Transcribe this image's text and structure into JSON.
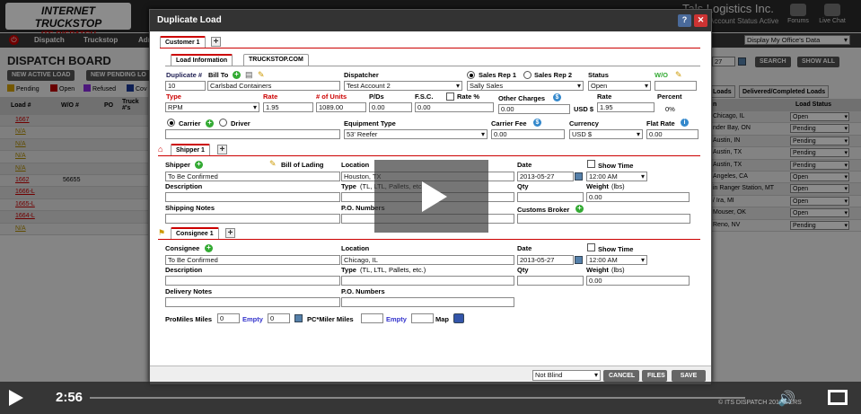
{
  "app": {
    "logo_main": "INTERNET TRUCKSTOP",
    "logo_sub": "ITS DISPATCH",
    "company": "Tals Logistics Inc.",
    "company_status": "Account Status Active",
    "forums": "Forums",
    "live_chat": "Live Chat"
  },
  "nav": [
    "Dispatch",
    "Truckstop",
    "Adm"
  ],
  "board": {
    "title": "DISPATCH BOARD",
    "new_active": "NEW ACTIVE LOAD",
    "new_pending": "NEW PENDING LO",
    "display_select": "Display My Office's Data",
    "date_partial": "27",
    "search": "SEARCH",
    "show_all": "SHOW ALL",
    "legend": [
      "Pending",
      "Open",
      "Refused",
      "Cov"
    ],
    "legend_colors": [
      "#d4a000",
      "#c00000",
      "#8a2be2",
      "#1a3a9a"
    ],
    "columns": [
      "Load #",
      "W/O #",
      "PO",
      "Truck #'s"
    ],
    "rows": [
      {
        "load": "1667",
        "wo": ""
      },
      {
        "load": "N/A",
        "wo": ""
      },
      {
        "load": "N/A",
        "wo": ""
      },
      {
        "load": "N/A",
        "wo": ""
      },
      {
        "load": "N/A",
        "wo": ""
      },
      {
        "load": "1662",
        "wo": "56655"
      },
      {
        "load": "1666-L",
        "wo": ""
      },
      {
        "load": "1665-L",
        "wo": ""
      },
      {
        "load": "1664-L",
        "wo": ""
      },
      {
        "load": "N/A",
        "wo": ""
      }
    ],
    "right_tabs": [
      "Loads",
      "Delivered/Completed Loads"
    ],
    "right_cols": [
      "n",
      "Load Status"
    ],
    "right_rows": [
      {
        "city": "Chicago, IL",
        "status": "Open"
      },
      {
        "city": "nder Bay, ON",
        "status": "Pending"
      },
      {
        "city": "Austin, IN",
        "status": "Pending"
      },
      {
        "city": "Austin, TX",
        "status": "Pending"
      },
      {
        "city": "Austin, TX",
        "status": "Pending"
      },
      {
        "city": "Angeles, CA",
        "status": "Open"
      },
      {
        "city": "in Ranger Station, MT",
        "status": "Open"
      },
      {
        "city": "/ Ira, MI",
        "status": "Open"
      },
      {
        "city": "Mouser, OK",
        "status": "Open"
      },
      {
        "city": "Reno, NV",
        "status": "Pending"
      }
    ]
  },
  "modal": {
    "title": "Duplicate Load",
    "customer_tab": "Customer 1",
    "tab_load_info": "Load Information",
    "tab_truckstop": "TRUCKSTOP.COM",
    "duplicate_label": "Duplicate #",
    "bill_to_label": "Bill To",
    "duplicate_value": "10",
    "bill_to_value": "Carlsbad Containers",
    "dispatcher_label": "Dispatcher",
    "dispatcher_value": "Test Account 2",
    "sales_rep1": "Sales Rep 1",
    "sales_rep2": "Sales Rep 2",
    "sales_value": "Sally Sales",
    "status_label": "Status",
    "status_value": "Open",
    "wo_label": "W/O",
    "wo_value": "",
    "type_label": "Type",
    "type_value": "RPM",
    "rate_label": "Rate",
    "rate_value": "1.95",
    "units_label": "# of Units",
    "units_value": "1089.00",
    "pd_label": "P/Ds",
    "pd_value": "0.00",
    "fsc_label": "F.S.C.",
    "fsc_value": "0.00",
    "rate_pct_label": "Rate %",
    "other_label": "Other Charges",
    "other_value": "0.00",
    "usd_label": "USD $",
    "rate2_label": "Rate",
    "rate2_value": "1.95",
    "percent_label": "Percent",
    "percent_value": "0%",
    "carrier_label": "Carrier",
    "driver_label": "Driver",
    "carrier_value": "",
    "equip_label": "Equipment Type",
    "equip_value": "53' Reefer",
    "carrier_fee_label": "Carrier Fee",
    "carrier_fee_value": "0.00",
    "currency_label": "Currency",
    "currency_value": "USD $",
    "flat_rate_label": "Flat Rate",
    "flat_rate_value": "0.00",
    "shipper_tab": "Shipper 1",
    "shipper_label": "Shipper",
    "bol_label": "Bill of Lading",
    "shipper_value": "To Be Confirmed",
    "location_label": "Location",
    "shipper_location": "Houston, TX",
    "date_label": "Date",
    "shipper_date": "2013-05-27",
    "show_time": "Show Time",
    "shipper_time": "12:00 AM",
    "description_label": "Description",
    "type_tl_label": "Type",
    "type_tl_hint": "(TL, LTL, Pallets, etc.)",
    "qty_label": "Qty",
    "weight_label": "Weight",
    "weight_unit": "(lbs)",
    "shipper_weight": "0.00",
    "shipping_notes_label": "Shipping Notes",
    "po_label": "P.O. Numbers",
    "customs_label": "Customs Broker",
    "consignee_tab": "Consignee 1",
    "consignee_label": "Consignee",
    "consignee_value": "To Be Confirmed",
    "consignee_location": "Chicago, IL",
    "consignee_date": "2013-05-27",
    "consignee_time": "12:00 AM",
    "consignee_weight": "0.00",
    "delivery_notes_label": "Delivery Notes",
    "promiles_label": "ProMiles Miles",
    "promiles_value": "0",
    "empty_label": "Empty",
    "empty_value": "0",
    "pcmiler_label": "PC*Miler Miles",
    "empty2_label": "Empty",
    "map_label": "Map",
    "blind_value": "Not Blind",
    "cancel": "CANCEL",
    "files": "FILES",
    "save": "SAVE"
  },
  "video": {
    "time": "2:56",
    "copyright": "© ITS DISPATCH 2013",
    "version": "VERS"
  }
}
